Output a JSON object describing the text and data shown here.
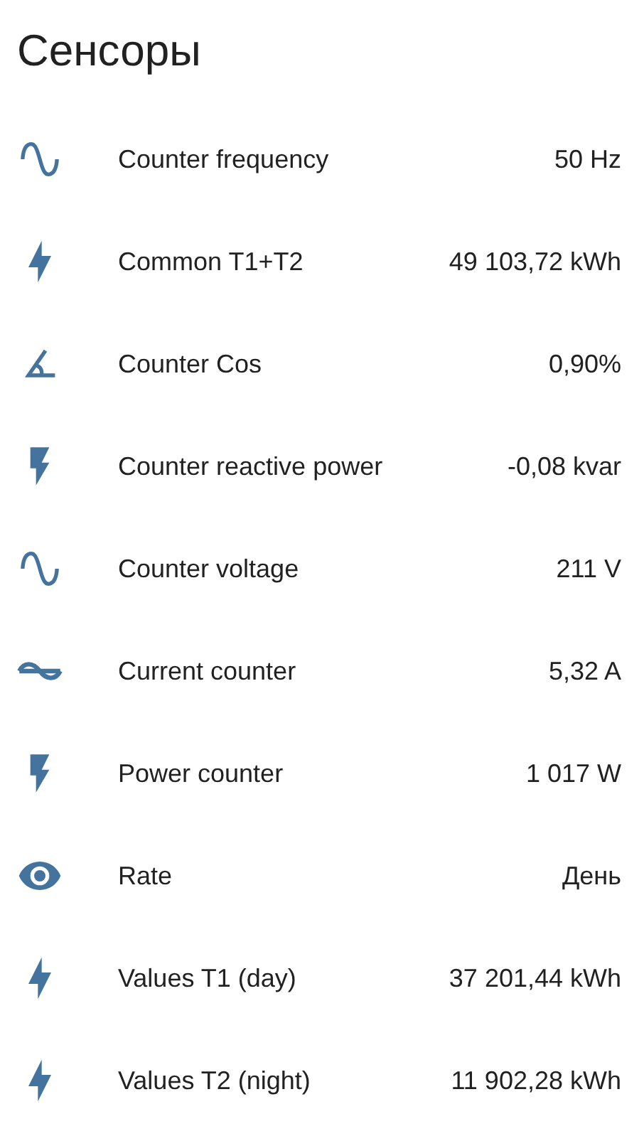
{
  "title": "Сенсоры",
  "sensors": [
    {
      "kind": "sine",
      "name": "Counter frequency",
      "value": "50 Hz"
    },
    {
      "kind": "lightning",
      "name": "Common T1+T2",
      "value": "49 103,72 kWh"
    },
    {
      "kind": "angle",
      "name": "Counter Cos",
      "value": "0,90%"
    },
    {
      "kind": "flash",
      "name": "Counter reactive power",
      "value": "-0,08 kvar"
    },
    {
      "kind": "sine",
      "name": "Counter voltage",
      "value": "211 V"
    },
    {
      "kind": "current",
      "name": "Current counter",
      "value": "5,32 A"
    },
    {
      "kind": "flash",
      "name": "Power counter",
      "value": "1 017 W"
    },
    {
      "kind": "eye",
      "name": "Rate",
      "value": "День"
    },
    {
      "kind": "lightning",
      "name": "Values T1 (day)",
      "value": "37 201,44 kWh"
    },
    {
      "kind": "lightning",
      "name": "Values T2 (night)",
      "value": "11 902,28 kWh"
    }
  ]
}
